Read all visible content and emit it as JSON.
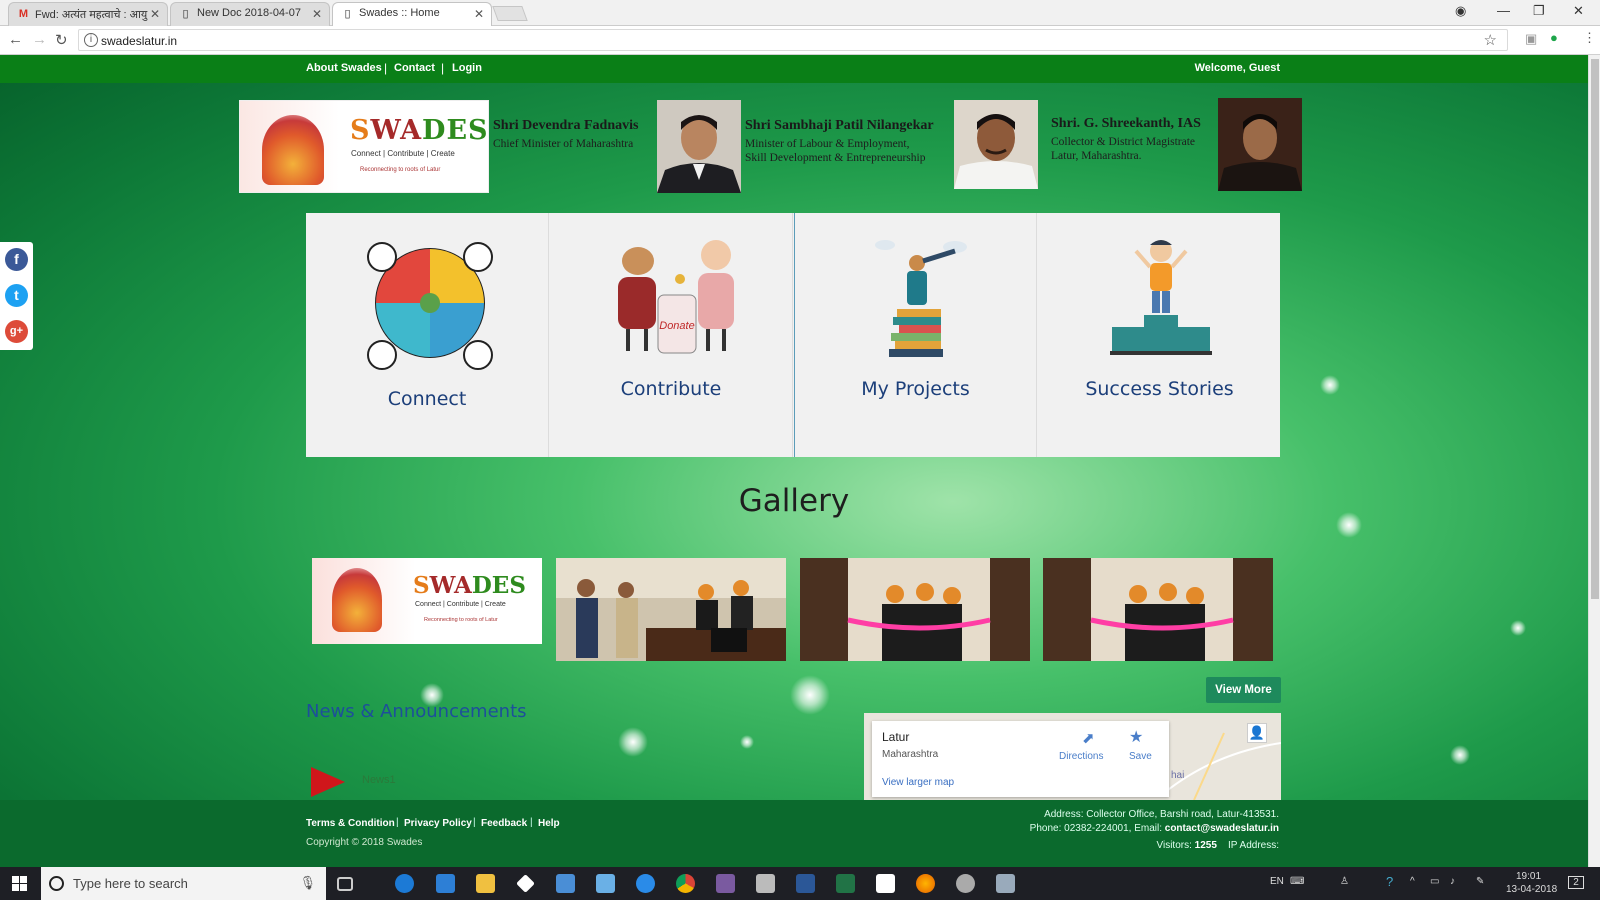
{
  "browser": {
    "tabs": [
      {
        "title": "Fwd: अत्यंत महत्वाचे : आयु",
        "icon": "gmail-icon"
      },
      {
        "title": "New Doc 2018-04-07",
        "icon": "page-icon"
      },
      {
        "title": "Swades :: Home",
        "icon": "page-icon"
      }
    ],
    "url": "swadeslatur.in"
  },
  "topnav": {
    "about": "About Swades",
    "contact": "Contact",
    "login": "Login",
    "sep": "|",
    "welcome": "Welcome, Guest"
  },
  "header": {
    "logo": {
      "brand_s": "S",
      "brand_wa": "WA",
      "brand_des": "DES",
      "tagline": "Connect | Contribute | Create",
      "sub": "Reconnecting to roots of Latur"
    },
    "people": [
      {
        "name": "Shri Devendra Fadnavis",
        "role1": "Chief Minister of Maharashtra",
        "role2": ""
      },
      {
        "name": "Shri Sambhaji Patil Nilangekar",
        "role1": "Minister of Labour & Employment,",
        "role2": "Skill Development & Entrepreneurship"
      },
      {
        "name": "Shri. G. Shreekanth, IAS",
        "role1": "Collector & District Magistrate",
        "role2": "Latur, Maharashtra."
      }
    ]
  },
  "social": {
    "facebook": "f",
    "twitter": "t",
    "googleplus": "g+"
  },
  "tiles": [
    {
      "label": "Connect",
      "icon": "puzzle-globe-icon"
    },
    {
      "label": "Contribute",
      "icon": "donate-people-icon"
    },
    {
      "label": "My Projects",
      "icon": "telescope-books-icon"
    },
    {
      "label": "Success Stories",
      "icon": "podium-winner-icon"
    }
  ],
  "donate_text": "Donate",
  "gallery": {
    "title": "Gallery",
    "view_more": "View More"
  },
  "news": {
    "title": "News & Announcements",
    "items": [
      "News1"
    ]
  },
  "map": {
    "place": "Latur",
    "region": "Maharashtra",
    "directions": "Directions",
    "save": "Save",
    "larger": "View larger map",
    "label_hai": "hai"
  },
  "footer": {
    "links": [
      "Terms & Condition",
      "Privacy Policy",
      "Feedback",
      "Help"
    ],
    "sep": "|",
    "copyright": "Copyright © 2018 Swades",
    "address": "Address: Collector Office, Barshi road, Latur-413531.",
    "phone": "Phone: 02382-224001, Email: ",
    "email": "contact@swadeslatur.in",
    "visitors_label": "Visitors: ",
    "visitors": "1255",
    "ip_label": "IP Address:"
  },
  "taskbar": {
    "search_placeholder": "Type here to search",
    "lang": "EN",
    "time": "19:01",
    "date": "13-04-2018",
    "notifications": "2"
  },
  "colors": {
    "nav_green": "#0a7f17",
    "tile_text": "#1c3f7a",
    "view_more": "#1e8a5c",
    "news_title": "#1d4f9a"
  }
}
